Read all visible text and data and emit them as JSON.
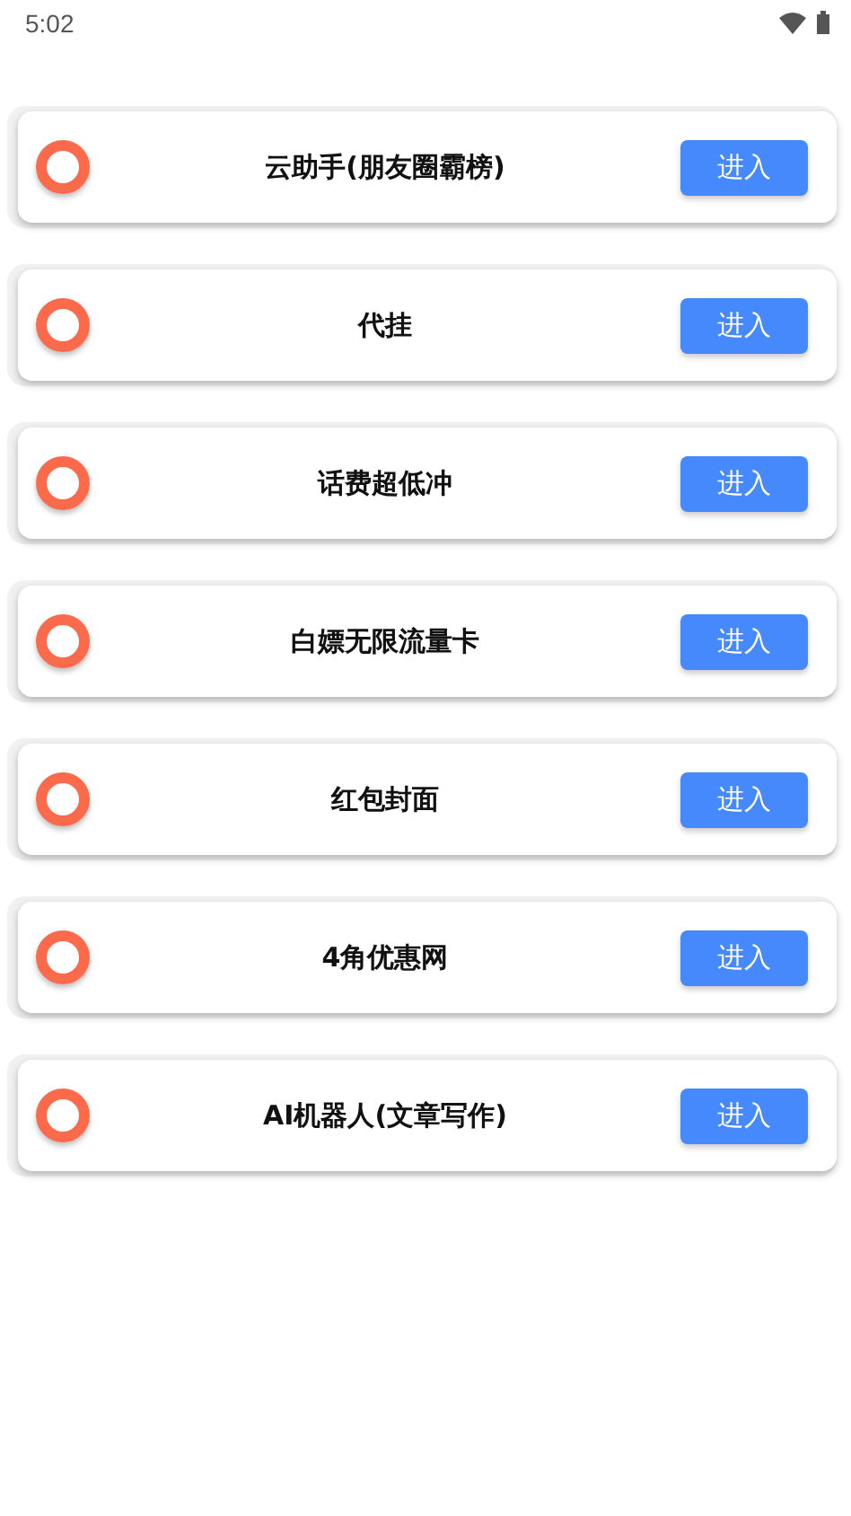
{
  "status_bar": {
    "time": "5:02"
  },
  "items": [
    {
      "title": "云助手(朋友圈霸榜)",
      "button": "进入"
    },
    {
      "title": "代挂",
      "button": "进入"
    },
    {
      "title": "话费超低冲",
      "button": "进入"
    },
    {
      "title": "白嫖无限流量卡",
      "button": "进入"
    },
    {
      "title": "红包封面",
      "button": "进入"
    },
    {
      "title": "4角优惠网",
      "button": "进入"
    },
    {
      "title": "AI机器人(文章写作)",
      "button": "进入"
    }
  ]
}
